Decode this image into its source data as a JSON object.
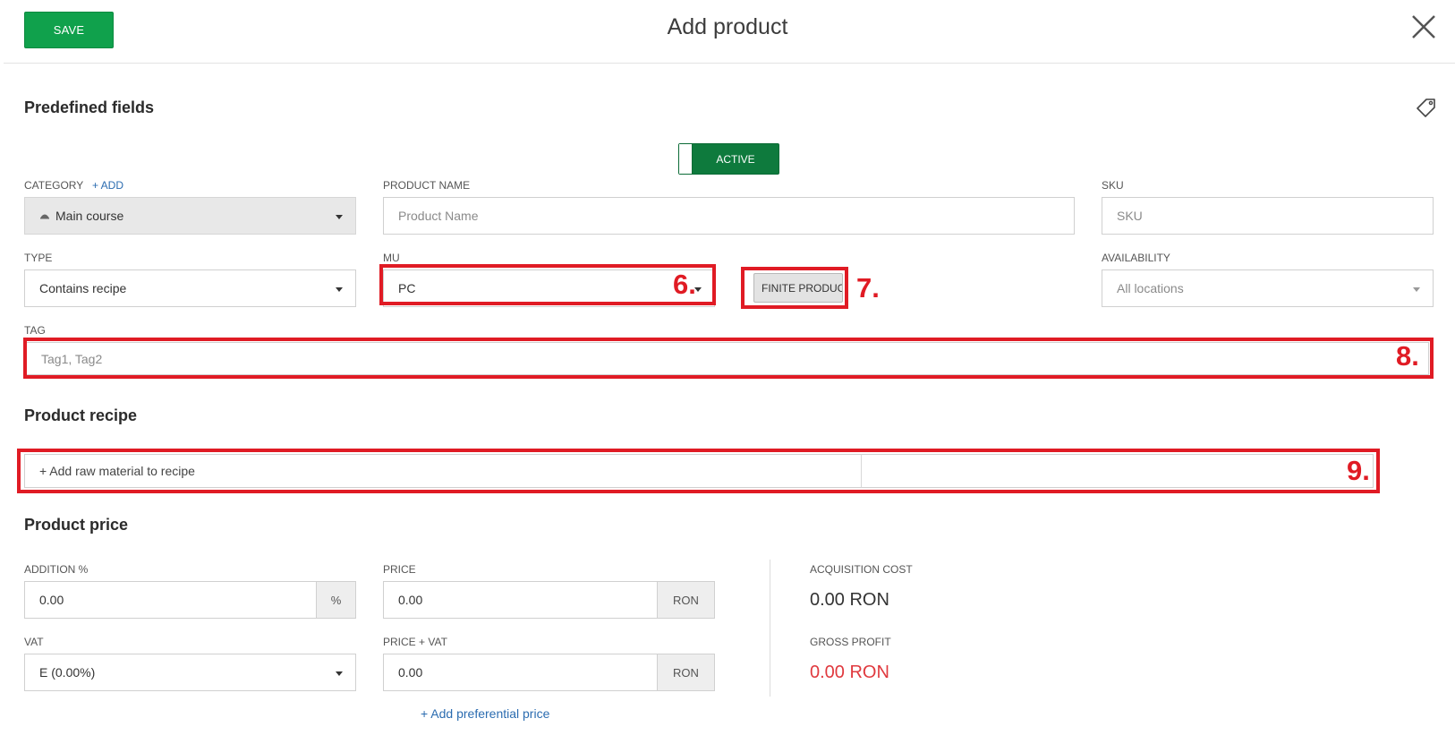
{
  "header": {
    "save_label": "SAVE",
    "title": "Add product"
  },
  "predefined": {
    "title": "Predefined fields",
    "status_toggle": "ACTIVE",
    "category": {
      "label": "CATEGORY",
      "add_link": "+ ADD",
      "value": "Main course",
      "icon": "dish-icon"
    },
    "product_name": {
      "label": "PRODUCT NAME",
      "placeholder": "Product Name"
    },
    "sku": {
      "label": "SKU",
      "placeholder": "SKU"
    },
    "type": {
      "label": "TYPE",
      "value": "Contains recipe"
    },
    "mu": {
      "label": "MU",
      "value": "PC"
    },
    "finite_product": "FINITE PRODUCT",
    "availability": {
      "label": "AVAILABILITY",
      "value": "All locations"
    },
    "tag": {
      "label": "TAG",
      "placeholder": "Tag1, Tag2"
    }
  },
  "recipe": {
    "title": "Product recipe",
    "add_raw_material": "+ Add raw material to recipe"
  },
  "price": {
    "title": "Product price",
    "addition": {
      "label": "ADDITION %",
      "value": "0.00",
      "suffix": "%"
    },
    "price": {
      "label": "PRICE",
      "value": "0.00",
      "suffix": "RON"
    },
    "vat": {
      "label": "VAT",
      "value": "E (0.00%)"
    },
    "price_vat": {
      "label": "PRICE + VAT",
      "value": "0.00",
      "suffix": "RON"
    },
    "acquisition_cost": {
      "label": "ACQUISITION COST",
      "value": "0.00 RON"
    },
    "gross_profit": {
      "label": "GROSS PROFIT",
      "value": "0.00 RON"
    },
    "add_preferential": "+ Add preferential price"
  },
  "annotations": [
    "6.",
    "7.",
    "8.",
    "9."
  ],
  "colors": {
    "save_green": "#10a14c",
    "toggle_green": "#0e7a3d",
    "annotation_red": "#e01b24",
    "link_blue": "#2b6cb0",
    "profit_red": "#e0393e"
  }
}
